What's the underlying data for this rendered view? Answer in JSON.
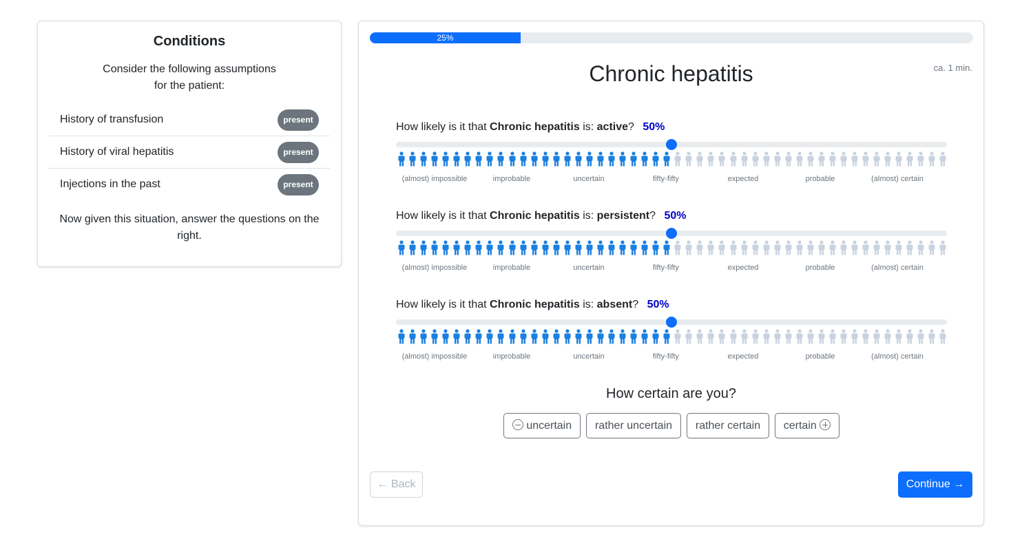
{
  "conditions": {
    "title": "Conditions",
    "intro_line1": "Consider the following assumptions",
    "intro_line2": "for the patient:",
    "items": [
      {
        "label": "History of transfusion",
        "badge": "present"
      },
      {
        "label": "History of viral hepatitis",
        "badge": "present"
      },
      {
        "label": "Injections in the past",
        "badge": "present"
      }
    ],
    "outro": "Now given this situation, answer the questions on the right."
  },
  "progress": {
    "label": "25%",
    "value_percent": 25
  },
  "main": {
    "title": "Chronic hepatitis",
    "time_estimate": "ca. 1 min."
  },
  "questions": [
    {
      "prefix": "How likely is it that",
      "disease": "Chronic hepatitis",
      "mid": "is:",
      "state": "active",
      "suffix": "?",
      "percent_label": "50%",
      "value_percent": 50
    },
    {
      "prefix": "How likely is it that",
      "disease": "Chronic hepatitis",
      "mid": "is:",
      "state": "persistent",
      "suffix": "?",
      "percent_label": "50%",
      "value_percent": 50
    },
    {
      "prefix": "How likely is it that",
      "disease": "Chronic hepatitis",
      "mid": "is:",
      "state": "absent",
      "suffix": "?",
      "percent_label": "50%",
      "value_percent": 50
    }
  ],
  "icon_array": {
    "total": 50,
    "filled_color": "#1a7fe0",
    "empty_color": "#c9d3df"
  },
  "scale_labels": [
    "(almost) impossible",
    "improbable",
    "uncertain",
    "fifty-fifty",
    "expected",
    "probable",
    "(almost) certain"
  ],
  "certainty": {
    "title": "How certain are you?",
    "options": [
      "uncertain",
      "rather uncertain",
      "rather certain",
      "certain"
    ]
  },
  "nav": {
    "back": "← Back",
    "continue": "Continue →"
  },
  "colors": {
    "accent": "#0d6efd",
    "badge": "#6c757d",
    "percent_text": "#0000cc"
  }
}
